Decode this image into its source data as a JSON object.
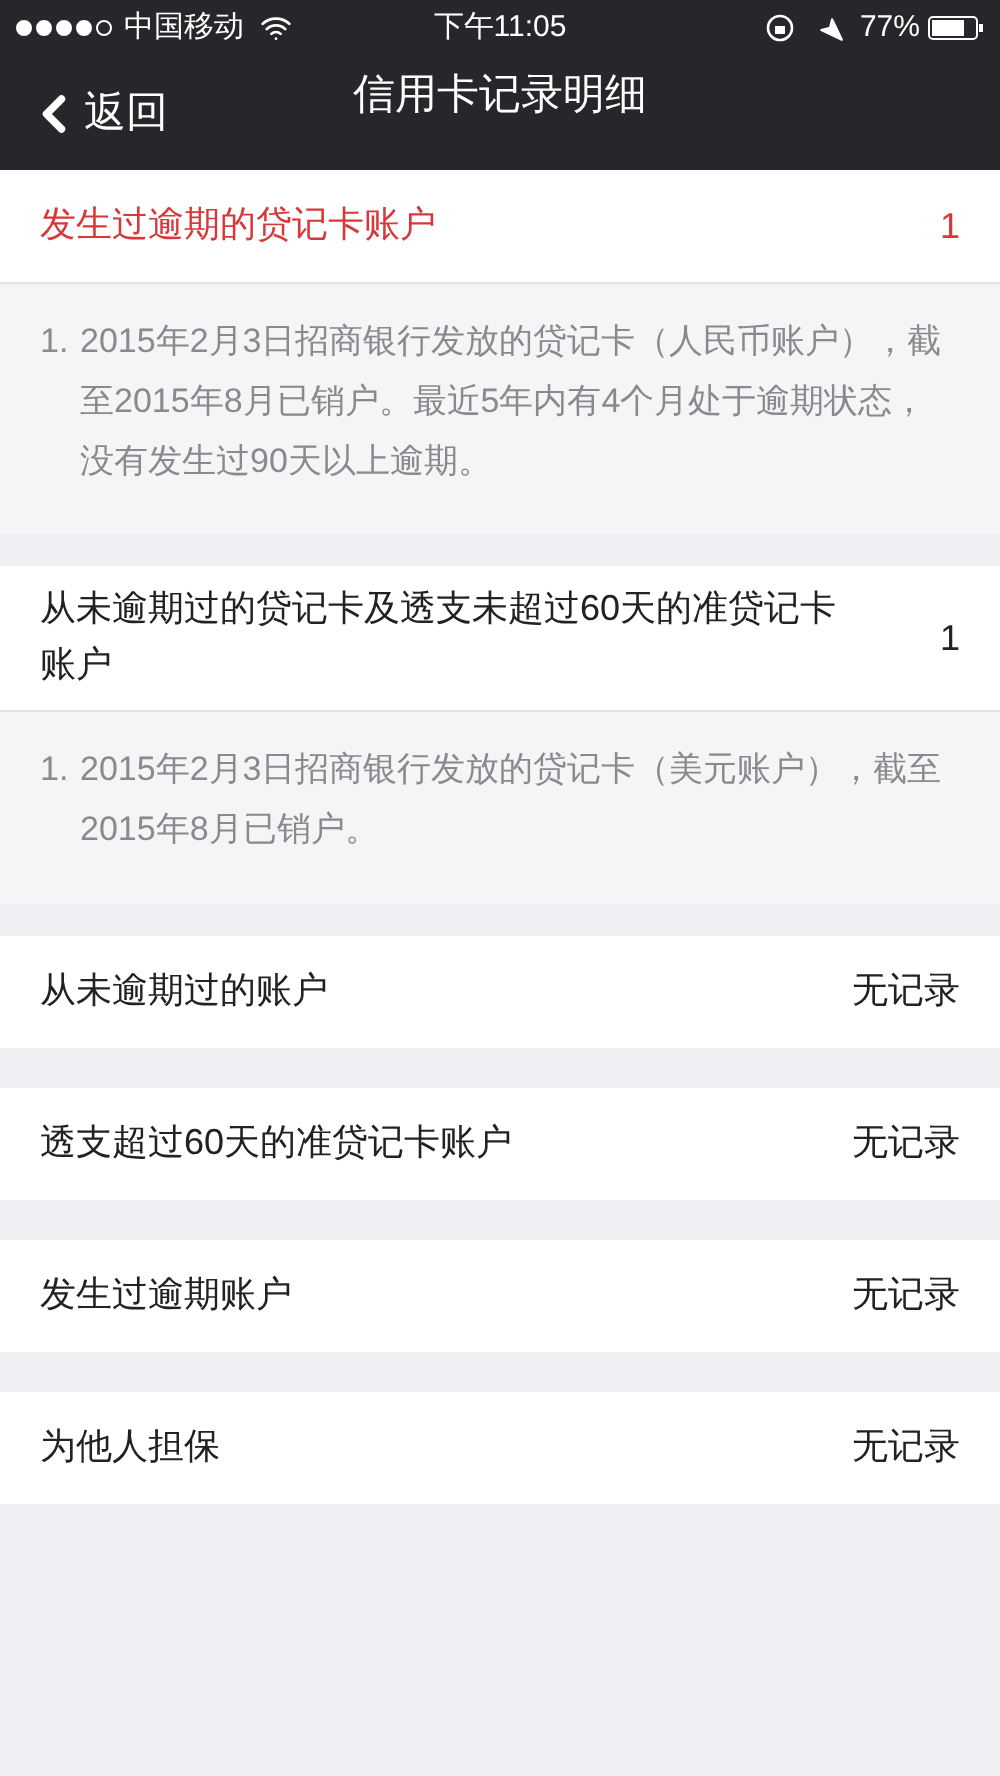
{
  "status_bar": {
    "carrier": "中国移动",
    "time": "下午11:05",
    "battery": "77%"
  },
  "nav": {
    "back": "返回",
    "title": "信用卡记录明细"
  },
  "sections": [
    {
      "label": "发生过逾期的贷记卡账户",
      "value": "1",
      "highlight": true,
      "details": [
        {
          "number": "1.",
          "text": "2015年2月3日招商银行发放的贷记卡（人民币账户），截至2015年8月已销户。最近5年内有4个月处于逾期状态，没有发生过90天以上逾期。"
        }
      ]
    },
    {
      "label": "从未逾期过的贷记卡及透支未超过60天的准贷记卡账户",
      "value": "1",
      "highlight": false,
      "details": [
        {
          "number": "1.",
          "text": "2015年2月3日招商银行发放的贷记卡（美元账户），截至2015年8月已销户。"
        }
      ]
    },
    {
      "label": "从未逾期过的账户",
      "value": "无记录",
      "highlight": false
    },
    {
      "label": "透支超过60天的准贷记卡账户",
      "value": "无记录",
      "highlight": false
    },
    {
      "label": "发生过逾期账户",
      "value": "无记录",
      "highlight": false
    },
    {
      "label": "为他人担保",
      "value": "无记录",
      "highlight": false
    }
  ]
}
